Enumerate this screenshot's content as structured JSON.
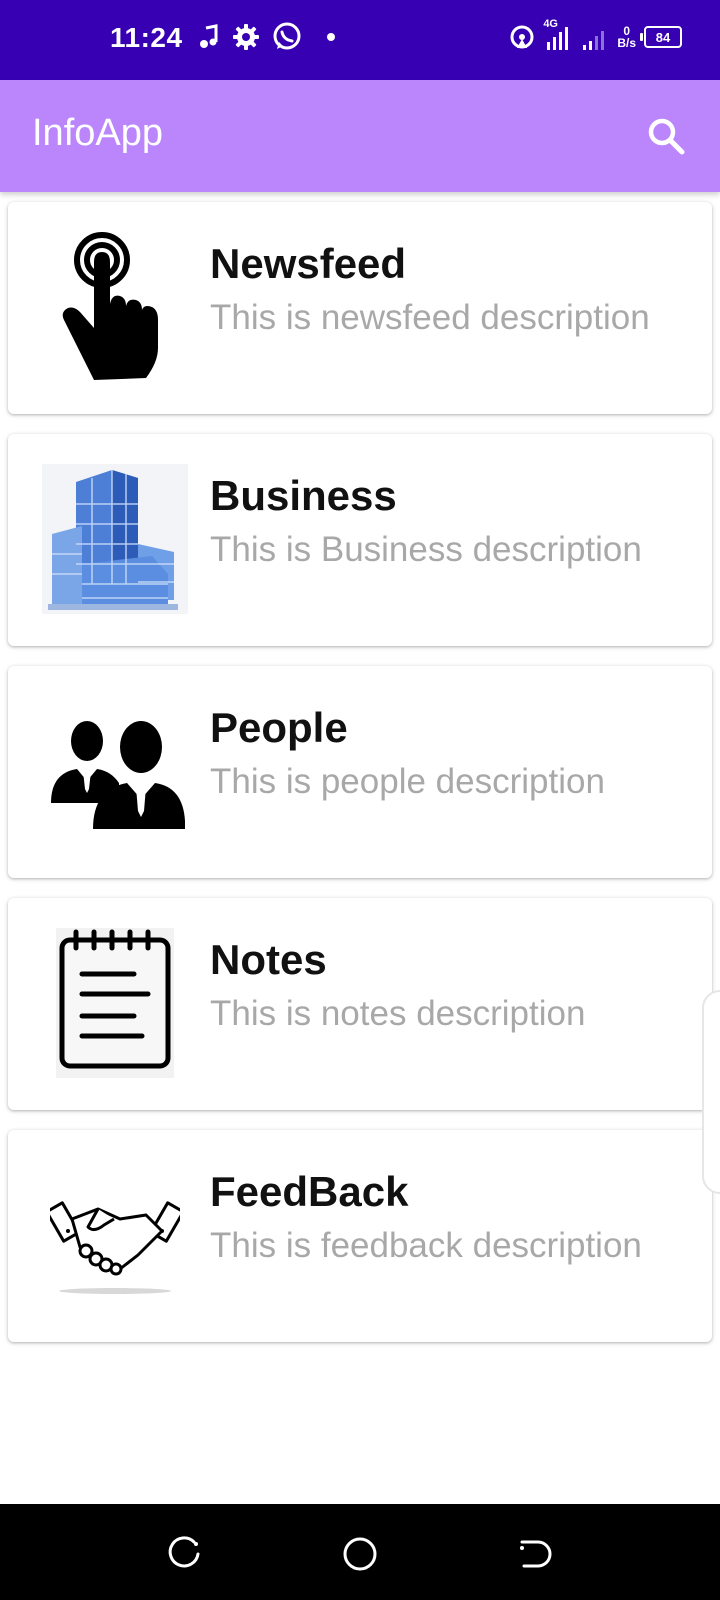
{
  "status_bar": {
    "time": "11:24",
    "network_type": "4G",
    "net_speed_value": "0",
    "net_speed_unit": "B/s",
    "battery": "84",
    "icons": [
      "music-note-icon",
      "gear-icon",
      "whatsapp-icon",
      "dot-icon",
      "hotspot-icon",
      "signal-icon",
      "battery-icon"
    ]
  },
  "app_bar": {
    "title": "InfoApp",
    "background_color": "#BB86FC",
    "status_bar_color": "#3700B3",
    "search_icon": "search-icon"
  },
  "items": [
    {
      "title": "Newsfeed",
      "description": "This is newsfeed description",
      "icon": "hand-pointer-icon"
    },
    {
      "title": "Business",
      "description": "This is Business description",
      "icon": "building-icon"
    },
    {
      "title": "People",
      "description": "This is people description",
      "icon": "people-icon"
    },
    {
      "title": "Notes",
      "description": "This is notes description",
      "icon": "notepad-icon"
    },
    {
      "title": "FeedBack",
      "description": "This is feedback description",
      "icon": "handshake-icon"
    }
  ],
  "nav_bar": {
    "buttons": [
      "recent-apps-icon",
      "home-icon",
      "back-icon"
    ]
  }
}
